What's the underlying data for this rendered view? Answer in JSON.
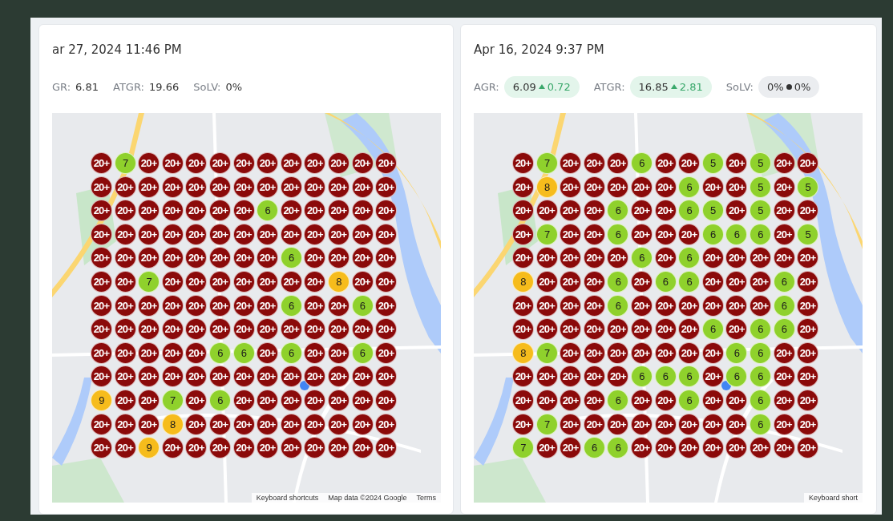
{
  "panels": [
    {
      "title": "ar 27, 2024 11:46 PM",
      "metrics": [
        {
          "label": "GR:",
          "value": "6.81"
        },
        {
          "label": "ATGR:",
          "value": "19.66"
        },
        {
          "label": "SoLV:",
          "value": "0%"
        }
      ],
      "map": {
        "kind": "picture",
        "attribution": [
          "Keyboard shortcuts",
          "Map data ©2024 Google",
          "Terms"
        ],
        "grid": [
          [
            {
              "rank": "20+",
              "color": "#8b0a0a"
            },
            {
              "rank": "7",
              "color": "#8fd12c"
            },
            {
              "rank": "20+",
              "color": "#8b0a0a"
            },
            {
              "rank": "20+",
              "color": "#8b0a0a"
            },
            {
              "rank": "20+",
              "color": "#8b0a0a"
            },
            {
              "rank": "20+",
              "color": "#8b0a0a"
            },
            {
              "rank": "20+",
              "color": "#8b0a0a"
            },
            {
              "rank": "20+",
              "color": "#8b0a0a"
            },
            {
              "rank": "20+",
              "color": "#8b0a0a"
            },
            {
              "rank": "20+",
              "color": "#8b0a0a"
            },
            {
              "rank": "20+",
              "color": "#8b0a0a"
            },
            {
              "rank": "20+",
              "color": "#8b0a0a"
            },
            {
              "rank": "20+",
              "color": "#8b0a0a"
            }
          ],
          [
            {
              "rank": "20+",
              "color": "#8b0a0a"
            },
            {
              "rank": "20+",
              "color": "#8b0a0a"
            },
            {
              "rank": "20+",
              "color": "#8b0a0a"
            },
            {
              "rank": "20+",
              "color": "#8b0a0a"
            },
            {
              "rank": "20+",
              "color": "#8b0a0a"
            },
            {
              "rank": "20+",
              "color": "#8b0a0a"
            },
            {
              "rank": "20+",
              "color": "#8b0a0a"
            },
            {
              "rank": "20+",
              "color": "#8b0a0a"
            },
            {
              "rank": "20+",
              "color": "#8b0a0a"
            },
            {
              "rank": "20+",
              "color": "#8b0a0a"
            },
            {
              "rank": "20+",
              "color": "#8b0a0a"
            },
            {
              "rank": "20+",
              "color": "#8b0a0a"
            },
            {
              "rank": "20+",
              "color": "#8b0a0a"
            }
          ],
          [
            {
              "rank": "20+",
              "color": "#8b0a0a"
            },
            {
              "rank": "20+",
              "color": "#8b0a0a"
            },
            {
              "rank": "20+",
              "color": "#8b0a0a"
            },
            {
              "rank": "20+",
              "color": "#8b0a0a"
            },
            {
              "rank": "20+",
              "color": "#8b0a0a"
            },
            {
              "rank": "20+",
              "color": "#8b0a0a"
            },
            {
              "rank": "20+",
              "color": "#8b0a0a"
            },
            {
              "rank": "6",
              "color": "#8fd12c"
            },
            {
              "rank": "20+",
              "color": "#8b0a0a"
            },
            {
              "rank": "20+",
              "color": "#8b0a0a"
            },
            {
              "rank": "20+",
              "color": "#8b0a0a"
            },
            {
              "rank": "20+",
              "color": "#8b0a0a"
            },
            {
              "rank": "20+",
              "color": "#8b0a0a"
            }
          ],
          [
            {
              "rank": "20+",
              "color": "#8b0a0a"
            },
            {
              "rank": "20+",
              "color": "#8b0a0a"
            },
            {
              "rank": "20+",
              "color": "#8b0a0a"
            },
            {
              "rank": "20+",
              "color": "#8b0a0a"
            },
            {
              "rank": "20+",
              "color": "#8b0a0a"
            },
            {
              "rank": "20+",
              "color": "#8b0a0a"
            },
            {
              "rank": "20+",
              "color": "#8b0a0a"
            },
            {
              "rank": "20+",
              "color": "#8b0a0a"
            },
            {
              "rank": "20+",
              "color": "#8b0a0a"
            },
            {
              "rank": "20+",
              "color": "#8b0a0a"
            },
            {
              "rank": "20+",
              "color": "#8b0a0a"
            },
            {
              "rank": "20+",
              "color": "#8b0a0a"
            },
            {
              "rank": "20+",
              "color": "#8b0a0a"
            }
          ],
          [
            {
              "rank": "20+",
              "color": "#8b0a0a"
            },
            {
              "rank": "20+",
              "color": "#8b0a0a"
            },
            {
              "rank": "20+",
              "color": "#8b0a0a"
            },
            {
              "rank": "20+",
              "color": "#8b0a0a"
            },
            {
              "rank": "20+",
              "color": "#8b0a0a"
            },
            {
              "rank": "20+",
              "color": "#8b0a0a"
            },
            {
              "rank": "20+",
              "color": "#8b0a0a"
            },
            {
              "rank": "20+",
              "color": "#8b0a0a"
            },
            {
              "rank": "6",
              "color": "#8fd12c"
            },
            {
              "rank": "20+",
              "color": "#8b0a0a"
            },
            {
              "rank": "20+",
              "color": "#8b0a0a"
            },
            {
              "rank": "20+",
              "color": "#8b0a0a"
            },
            {
              "rank": "20+",
              "color": "#8b0a0a"
            }
          ],
          [
            {
              "rank": "20+",
              "color": "#8b0a0a"
            },
            {
              "rank": "20+",
              "color": "#8b0a0a"
            },
            {
              "rank": "7",
              "color": "#8fd12c"
            },
            {
              "rank": "20+",
              "color": "#8b0a0a"
            },
            {
              "rank": "20+",
              "color": "#8b0a0a"
            },
            {
              "rank": "20+",
              "color": "#8b0a0a"
            },
            {
              "rank": "20+",
              "color": "#8b0a0a"
            },
            {
              "rank": "20+",
              "color": "#8b0a0a"
            },
            {
              "rank": "20+",
              "color": "#8b0a0a"
            },
            {
              "rank": "20+",
              "color": "#8b0a0a"
            },
            {
              "rank": "8",
              "color": "#f6bc1c"
            },
            {
              "rank": "20+",
              "color": "#8b0a0a"
            },
            {
              "rank": "20+",
              "color": "#8b0a0a"
            }
          ],
          [
            {
              "rank": "20+",
              "color": "#8b0a0a"
            },
            {
              "rank": "20+",
              "color": "#8b0a0a"
            },
            {
              "rank": "20+",
              "color": "#8b0a0a"
            },
            {
              "rank": "20+",
              "color": "#8b0a0a"
            },
            {
              "rank": "20+",
              "color": "#8b0a0a"
            },
            {
              "rank": "20+",
              "color": "#8b0a0a"
            },
            {
              "rank": "20+",
              "color": "#8b0a0a"
            },
            {
              "rank": "20+",
              "color": "#8b0a0a"
            },
            {
              "rank": "6",
              "color": "#8fd12c"
            },
            {
              "rank": "20+",
              "color": "#8b0a0a"
            },
            {
              "rank": "20+",
              "color": "#8b0a0a"
            },
            {
              "rank": "6",
              "color": "#8fd12c"
            },
            {
              "rank": "20+",
              "color": "#8b0a0a"
            }
          ],
          [
            {
              "rank": "20+",
              "color": "#8b0a0a"
            },
            {
              "rank": "20+",
              "color": "#8b0a0a"
            },
            {
              "rank": "20+",
              "color": "#8b0a0a"
            },
            {
              "rank": "20+",
              "color": "#8b0a0a"
            },
            {
              "rank": "20+",
              "color": "#8b0a0a"
            },
            {
              "rank": "20+",
              "color": "#8b0a0a"
            },
            {
              "rank": "20+",
              "color": "#8b0a0a"
            },
            {
              "rank": "20+",
              "color": "#8b0a0a"
            },
            {
              "rank": "20+",
              "color": "#8b0a0a"
            },
            {
              "rank": "20+",
              "color": "#8b0a0a"
            },
            {
              "rank": "20+",
              "color": "#8b0a0a"
            },
            {
              "rank": "20+",
              "color": "#8b0a0a"
            },
            {
              "rank": "20+",
              "color": "#8b0a0a"
            }
          ],
          [
            {
              "rank": "20+",
              "color": "#8b0a0a"
            },
            {
              "rank": "20+",
              "color": "#8b0a0a"
            },
            {
              "rank": "20+",
              "color": "#8b0a0a"
            },
            {
              "rank": "20+",
              "color": "#8b0a0a"
            },
            {
              "rank": "20+",
              "color": "#8b0a0a"
            },
            {
              "rank": "6",
              "color": "#8fd12c"
            },
            {
              "rank": "6",
              "color": "#8fd12c"
            },
            {
              "rank": "20+",
              "color": "#8b0a0a"
            },
            {
              "rank": "6",
              "color": "#8fd12c"
            },
            {
              "rank": "20+",
              "color": "#8b0a0a"
            },
            {
              "rank": "20+",
              "color": "#8b0a0a"
            },
            {
              "rank": "6",
              "color": "#8fd12c"
            },
            {
              "rank": "20+",
              "color": "#8b0a0a"
            }
          ],
          [
            {
              "rank": "20+",
              "color": "#8b0a0a"
            },
            {
              "rank": "20+",
              "color": "#8b0a0a"
            },
            {
              "rank": "20+",
              "color": "#8b0a0a"
            },
            {
              "rank": "20+",
              "color": "#8b0a0a"
            },
            {
              "rank": "20+",
              "color": "#8b0a0a"
            },
            {
              "rank": "20+",
              "color": "#8b0a0a"
            },
            {
              "rank": "20+",
              "color": "#8b0a0a"
            },
            {
              "rank": "20+",
              "color": "#8b0a0a"
            },
            {
              "rank": "20+",
              "color": "#8b0a0a"
            },
            {
              "rank": "20+",
              "color": "#8b0a0a"
            },
            {
              "rank": "20+",
              "color": "#8b0a0a"
            },
            {
              "rank": "20+",
              "color": "#8b0a0a"
            },
            {
              "rank": "20+",
              "color": "#8b0a0a"
            }
          ],
          [
            {
              "rank": "9",
              "color": "#f6bc1c"
            },
            {
              "rank": "20+",
              "color": "#8b0a0a"
            },
            {
              "rank": "20+",
              "color": "#8b0a0a"
            },
            {
              "rank": "7",
              "color": "#8fd12c"
            },
            {
              "rank": "20+",
              "color": "#8b0a0a"
            },
            {
              "rank": "6",
              "color": "#8fd12c"
            },
            {
              "rank": "20+",
              "color": "#8b0a0a"
            },
            {
              "rank": "20+",
              "color": "#8b0a0a"
            },
            {
              "rank": "20+",
              "color": "#8b0a0a"
            },
            {
              "rank": "20+",
              "color": "#8b0a0a"
            },
            {
              "rank": "20+",
              "color": "#8b0a0a"
            },
            {
              "rank": "20+",
              "color": "#8b0a0a"
            },
            {
              "rank": "20+",
              "color": "#8b0a0a"
            }
          ],
          [
            {
              "rank": "20+",
              "color": "#8b0a0a"
            },
            {
              "rank": "20+",
              "color": "#8b0a0a"
            },
            {
              "rank": "20+",
              "color": "#8b0a0a"
            },
            {
              "rank": "8",
              "color": "#f6bc1c"
            },
            {
              "rank": "20+",
              "color": "#8b0a0a"
            },
            {
              "rank": "20+",
              "color": "#8b0a0a"
            },
            {
              "rank": "20+",
              "color": "#8b0a0a"
            },
            {
              "rank": "20+",
              "color": "#8b0a0a"
            },
            {
              "rank": "20+",
              "color": "#8b0a0a"
            },
            {
              "rank": "20+",
              "color": "#8b0a0a"
            },
            {
              "rank": "20+",
              "color": "#8b0a0a"
            },
            {
              "rank": "20+",
              "color": "#8b0a0a"
            },
            {
              "rank": "20+",
              "color": "#8b0a0a"
            }
          ],
          [
            {
              "rank": "20+",
              "color": "#8b0a0a"
            },
            {
              "rank": "20+",
              "color": "#8b0a0a"
            },
            {
              "rank": "9",
              "color": "#f6bc1c"
            },
            {
              "rank": "20+",
              "color": "#8b0a0a"
            },
            {
              "rank": "20+",
              "color": "#8b0a0a"
            },
            {
              "rank": "20+",
              "color": "#8b0a0a"
            },
            {
              "rank": "20+",
              "color": "#8b0a0a"
            },
            {
              "rank": "20+",
              "color": "#8b0a0a"
            },
            {
              "rank": "20+",
              "color": "#8b0a0a"
            },
            {
              "rank": "20+",
              "color": "#8b0a0a"
            },
            {
              "rank": "20+",
              "color": "#8b0a0a"
            },
            {
              "rank": "20+",
              "color": "#8b0a0a"
            },
            {
              "rank": "20+",
              "color": "#8b0a0a"
            }
          ]
        ]
      }
    },
    {
      "title": "Apr 16, 2024 9:37 PM",
      "metrics": [
        {
          "label": "AGR:",
          "value": "6.09",
          "change": {
            "kind": "up",
            "value": "0.72"
          }
        },
        {
          "label": "ATGR:",
          "value": "16.85",
          "change": {
            "kind": "up",
            "value": "2.81"
          }
        },
        {
          "label": "SoLV:",
          "value": "0%",
          "change": {
            "kind": "flat",
            "value": "0%"
          }
        }
      ],
      "map": {
        "kind": "picture",
        "attribution": [
          "Keyboard short"
        ],
        "grid": [
          [
            {
              "rank": "20+",
              "color": "#8b0a0a"
            },
            {
              "rank": "7",
              "color": "#8fd12c"
            },
            {
              "rank": "20+",
              "color": "#8b0a0a"
            },
            {
              "rank": "20+",
              "color": "#8b0a0a"
            },
            {
              "rank": "20+",
              "color": "#8b0a0a"
            },
            {
              "rank": "6",
              "color": "#8fd12c"
            },
            {
              "rank": "20+",
              "color": "#8b0a0a"
            },
            {
              "rank": "20+",
              "color": "#8b0a0a"
            },
            {
              "rank": "5",
              "color": "#8fd12c"
            },
            {
              "rank": "20+",
              "color": "#8b0a0a"
            },
            {
              "rank": "5",
              "color": "#8fd12c"
            },
            {
              "rank": "20+",
              "color": "#8b0a0a"
            },
            {
              "rank": "20+",
              "color": "#8b0a0a"
            }
          ],
          [
            {
              "rank": "20+",
              "color": "#8b0a0a"
            },
            {
              "rank": "8",
              "color": "#f6bc1c"
            },
            {
              "rank": "20+",
              "color": "#8b0a0a"
            },
            {
              "rank": "20+",
              "color": "#8b0a0a"
            },
            {
              "rank": "20+",
              "color": "#8b0a0a"
            },
            {
              "rank": "20+",
              "color": "#8b0a0a"
            },
            {
              "rank": "20+",
              "color": "#8b0a0a"
            },
            {
              "rank": "6",
              "color": "#8fd12c"
            },
            {
              "rank": "20+",
              "color": "#8b0a0a"
            },
            {
              "rank": "20+",
              "color": "#8b0a0a"
            },
            {
              "rank": "5",
              "color": "#8fd12c"
            },
            {
              "rank": "20+",
              "color": "#8b0a0a"
            },
            {
              "rank": "5",
              "color": "#8fd12c"
            }
          ],
          [
            {
              "rank": "20+",
              "color": "#8b0a0a"
            },
            {
              "rank": "20+",
              "color": "#8b0a0a"
            },
            {
              "rank": "20+",
              "color": "#8b0a0a"
            },
            {
              "rank": "20+",
              "color": "#8b0a0a"
            },
            {
              "rank": "6",
              "color": "#8fd12c"
            },
            {
              "rank": "20+",
              "color": "#8b0a0a"
            },
            {
              "rank": "20+",
              "color": "#8b0a0a"
            },
            {
              "rank": "6",
              "color": "#8fd12c"
            },
            {
              "rank": "5",
              "color": "#8fd12c"
            },
            {
              "rank": "20+",
              "color": "#8b0a0a"
            },
            {
              "rank": "5",
              "color": "#8fd12c"
            },
            {
              "rank": "20+",
              "color": "#8b0a0a"
            },
            {
              "rank": "20+",
              "color": "#8b0a0a"
            }
          ],
          [
            {
              "rank": "20+",
              "color": "#8b0a0a"
            },
            {
              "rank": "7",
              "color": "#8fd12c"
            },
            {
              "rank": "20+",
              "color": "#8b0a0a"
            },
            {
              "rank": "20+",
              "color": "#8b0a0a"
            },
            {
              "rank": "6",
              "color": "#8fd12c"
            },
            {
              "rank": "20+",
              "color": "#8b0a0a"
            },
            {
              "rank": "20+",
              "color": "#8b0a0a"
            },
            {
              "rank": "20+",
              "color": "#8b0a0a"
            },
            {
              "rank": "6",
              "color": "#8fd12c"
            },
            {
              "rank": "6",
              "color": "#8fd12c"
            },
            {
              "rank": "6",
              "color": "#8fd12c"
            },
            {
              "rank": "20+",
              "color": "#8b0a0a"
            },
            {
              "rank": "5",
              "color": "#8fd12c"
            }
          ],
          [
            {
              "rank": "20+",
              "color": "#8b0a0a"
            },
            {
              "rank": "20+",
              "color": "#8b0a0a"
            },
            {
              "rank": "20+",
              "color": "#8b0a0a"
            },
            {
              "rank": "20+",
              "color": "#8b0a0a"
            },
            {
              "rank": "20+",
              "color": "#8b0a0a"
            },
            {
              "rank": "6",
              "color": "#8fd12c"
            },
            {
              "rank": "20+",
              "color": "#8b0a0a"
            },
            {
              "rank": "6",
              "color": "#8fd12c"
            },
            {
              "rank": "20+",
              "color": "#8b0a0a"
            },
            {
              "rank": "20+",
              "color": "#8b0a0a"
            },
            {
              "rank": "20+",
              "color": "#8b0a0a"
            },
            {
              "rank": "20+",
              "color": "#8b0a0a"
            },
            {
              "rank": "20+",
              "color": "#8b0a0a"
            }
          ],
          [
            {
              "rank": "8",
              "color": "#f6bc1c"
            },
            {
              "rank": "20+",
              "color": "#8b0a0a"
            },
            {
              "rank": "20+",
              "color": "#8b0a0a"
            },
            {
              "rank": "20+",
              "color": "#8b0a0a"
            },
            {
              "rank": "6",
              "color": "#8fd12c"
            },
            {
              "rank": "20+",
              "color": "#8b0a0a"
            },
            {
              "rank": "6",
              "color": "#8fd12c"
            },
            {
              "rank": "6",
              "color": "#8fd12c"
            },
            {
              "rank": "20+",
              "color": "#8b0a0a"
            },
            {
              "rank": "20+",
              "color": "#8b0a0a"
            },
            {
              "rank": "20+",
              "color": "#8b0a0a"
            },
            {
              "rank": "6",
              "color": "#8fd12c"
            },
            {
              "rank": "20+",
              "color": "#8b0a0a"
            }
          ],
          [
            {
              "rank": "20+",
              "color": "#8b0a0a"
            },
            {
              "rank": "20+",
              "color": "#8b0a0a"
            },
            {
              "rank": "20+",
              "color": "#8b0a0a"
            },
            {
              "rank": "20+",
              "color": "#8b0a0a"
            },
            {
              "rank": "6",
              "color": "#8fd12c"
            },
            {
              "rank": "20+",
              "color": "#8b0a0a"
            },
            {
              "rank": "20+",
              "color": "#8b0a0a"
            },
            {
              "rank": "20+",
              "color": "#8b0a0a"
            },
            {
              "rank": "20+",
              "color": "#8b0a0a"
            },
            {
              "rank": "20+",
              "color": "#8b0a0a"
            },
            {
              "rank": "20+",
              "color": "#8b0a0a"
            },
            {
              "rank": "6",
              "color": "#8fd12c"
            },
            {
              "rank": "20+",
              "color": "#8b0a0a"
            }
          ],
          [
            {
              "rank": "20+",
              "color": "#8b0a0a"
            },
            {
              "rank": "20+",
              "color": "#8b0a0a"
            },
            {
              "rank": "20+",
              "color": "#8b0a0a"
            },
            {
              "rank": "20+",
              "color": "#8b0a0a"
            },
            {
              "rank": "20+",
              "color": "#8b0a0a"
            },
            {
              "rank": "20+",
              "color": "#8b0a0a"
            },
            {
              "rank": "20+",
              "color": "#8b0a0a"
            },
            {
              "rank": "20+",
              "color": "#8b0a0a"
            },
            {
              "rank": "6",
              "color": "#8fd12c"
            },
            {
              "rank": "20+",
              "color": "#8b0a0a"
            },
            {
              "rank": "6",
              "color": "#8fd12c"
            },
            {
              "rank": "6",
              "color": "#8fd12c"
            },
            {
              "rank": "20+",
              "color": "#8b0a0a"
            }
          ],
          [
            {
              "rank": "8",
              "color": "#f6bc1c"
            },
            {
              "rank": "7",
              "color": "#8fd12c"
            },
            {
              "rank": "20+",
              "color": "#8b0a0a"
            },
            {
              "rank": "20+",
              "color": "#8b0a0a"
            },
            {
              "rank": "20+",
              "color": "#8b0a0a"
            },
            {
              "rank": "20+",
              "color": "#8b0a0a"
            },
            {
              "rank": "20+",
              "color": "#8b0a0a"
            },
            {
              "rank": "20+",
              "color": "#8b0a0a"
            },
            {
              "rank": "20+",
              "color": "#8b0a0a"
            },
            {
              "rank": "6",
              "color": "#8fd12c"
            },
            {
              "rank": "6",
              "color": "#8fd12c"
            },
            {
              "rank": "20+",
              "color": "#8b0a0a"
            },
            {
              "rank": "20+",
              "color": "#8b0a0a"
            }
          ],
          [
            {
              "rank": "20+",
              "color": "#8b0a0a"
            },
            {
              "rank": "20+",
              "color": "#8b0a0a"
            },
            {
              "rank": "20+",
              "color": "#8b0a0a"
            },
            {
              "rank": "20+",
              "color": "#8b0a0a"
            },
            {
              "rank": "20+",
              "color": "#8b0a0a"
            },
            {
              "rank": "6",
              "color": "#8fd12c"
            },
            {
              "rank": "6",
              "color": "#8fd12c"
            },
            {
              "rank": "6",
              "color": "#8fd12c"
            },
            {
              "rank": "20+",
              "color": "#8b0a0a"
            },
            {
              "rank": "6",
              "color": "#8fd12c"
            },
            {
              "rank": "6",
              "color": "#8fd12c"
            },
            {
              "rank": "20+",
              "color": "#8b0a0a"
            },
            {
              "rank": "20+",
              "color": "#8b0a0a"
            }
          ],
          [
            {
              "rank": "20+",
              "color": "#8b0a0a"
            },
            {
              "rank": "20+",
              "color": "#8b0a0a"
            },
            {
              "rank": "20+",
              "color": "#8b0a0a"
            },
            {
              "rank": "20+",
              "color": "#8b0a0a"
            },
            {
              "rank": "6",
              "color": "#8fd12c"
            },
            {
              "rank": "20+",
              "color": "#8b0a0a"
            },
            {
              "rank": "20+",
              "color": "#8b0a0a"
            },
            {
              "rank": "6",
              "color": "#8fd12c"
            },
            {
              "rank": "20+",
              "color": "#8b0a0a"
            },
            {
              "rank": "20+",
              "color": "#8b0a0a"
            },
            {
              "rank": "6",
              "color": "#8fd12c"
            },
            {
              "rank": "20+",
              "color": "#8b0a0a"
            },
            {
              "rank": "20+",
              "color": "#8b0a0a"
            }
          ],
          [
            {
              "rank": "20+",
              "color": "#8b0a0a"
            },
            {
              "rank": "7",
              "color": "#8fd12c"
            },
            {
              "rank": "20+",
              "color": "#8b0a0a"
            },
            {
              "rank": "20+",
              "color": "#8b0a0a"
            },
            {
              "rank": "20+",
              "color": "#8b0a0a"
            },
            {
              "rank": "20+",
              "color": "#8b0a0a"
            },
            {
              "rank": "20+",
              "color": "#8b0a0a"
            },
            {
              "rank": "20+",
              "color": "#8b0a0a"
            },
            {
              "rank": "20+",
              "color": "#8b0a0a"
            },
            {
              "rank": "20+",
              "color": "#8b0a0a"
            },
            {
              "rank": "6",
              "color": "#8fd12c"
            },
            {
              "rank": "20+",
              "color": "#8b0a0a"
            },
            {
              "rank": "20+",
              "color": "#8b0a0a"
            }
          ],
          [
            {
              "rank": "7",
              "color": "#8fd12c"
            },
            {
              "rank": "20+",
              "color": "#8b0a0a"
            },
            {
              "rank": "20+",
              "color": "#8b0a0a"
            },
            {
              "rank": "6",
              "color": "#8fd12c"
            },
            {
              "rank": "6",
              "color": "#8fd12c"
            },
            {
              "rank": "20+",
              "color": "#8b0a0a"
            },
            {
              "rank": "20+",
              "color": "#8b0a0a"
            },
            {
              "rank": "20+",
              "color": "#8b0a0a"
            },
            {
              "rank": "20+",
              "color": "#8b0a0a"
            },
            {
              "rank": "20+",
              "color": "#8b0a0a"
            },
            {
              "rank": "20+",
              "color": "#8b0a0a"
            },
            {
              "rank": "20+",
              "color": "#8b0a0a"
            },
            {
              "rank": "20+",
              "color": "#8b0a0a"
            }
          ]
        ]
      }
    }
  ]
}
